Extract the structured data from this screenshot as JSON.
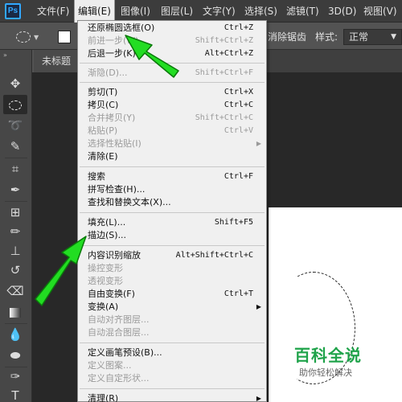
{
  "menubar": {
    "logo": "Ps",
    "items": [
      "文件(F)",
      "编辑(E)",
      "图像(I)",
      "图层(L)",
      "文字(Y)",
      "选择(S)",
      "滤镜(T)",
      "3D(D)",
      "视图(V)"
    ]
  },
  "options": {
    "antialias_label": "消除锯齿",
    "style_label": "样式:",
    "style_value": "正常"
  },
  "document": {
    "tab_title": "未标题"
  },
  "edit_menu": [
    {
      "label": "还原椭圆选框(O)",
      "shortcut": "Ctrl+Z",
      "disabled": false
    },
    {
      "label": "前进一步(W)",
      "shortcut": "Shift+Ctrl+Z",
      "disabled": true
    },
    {
      "label": "后退一步(K)",
      "shortcut": "Alt+Ctrl+Z",
      "disabled": false
    },
    {
      "label": "渐隐(D)...",
      "shortcut": "Shift+Ctrl+F",
      "disabled": true
    },
    {
      "label": "剪切(T)",
      "shortcut": "Ctrl+X",
      "disabled": false
    },
    {
      "label": "拷贝(C)",
      "shortcut": "Ctrl+C",
      "disabled": false
    },
    {
      "label": "合并拷贝(Y)",
      "shortcut": "Shift+Ctrl+C",
      "disabled": true
    },
    {
      "label": "粘贴(P)",
      "shortcut": "Ctrl+V",
      "disabled": true
    },
    {
      "label": "选择性粘贴(I)",
      "shortcut": "",
      "disabled": true,
      "submenu": true
    },
    {
      "label": "清除(E)",
      "shortcut": "",
      "disabled": false
    },
    {
      "label": "搜索",
      "shortcut": "Ctrl+F",
      "disabled": false
    },
    {
      "label": "拼写检查(H)...",
      "shortcut": "",
      "disabled": false
    },
    {
      "label": "查找和替换文本(X)...",
      "shortcut": "",
      "disabled": false
    },
    {
      "label": "填充(L)...",
      "shortcut": "Shift+F5",
      "disabled": false
    },
    {
      "label": "描边(S)...",
      "shortcut": "",
      "disabled": false
    },
    {
      "label": "内容识别缩放",
      "shortcut": "Alt+Shift+Ctrl+C",
      "disabled": false
    },
    {
      "label": "操控变形",
      "shortcut": "",
      "disabled": true
    },
    {
      "label": "透视变形",
      "shortcut": "",
      "disabled": true
    },
    {
      "label": "自由变换(F)",
      "shortcut": "Ctrl+T",
      "disabled": false
    },
    {
      "label": "变换(A)",
      "shortcut": "",
      "disabled": false,
      "submenu": true
    },
    {
      "label": "自动对齐图层...",
      "shortcut": "",
      "disabled": true
    },
    {
      "label": "自动混合图层...",
      "shortcut": "",
      "disabled": true
    },
    {
      "label": "定义画笔预设(B)...",
      "shortcut": "",
      "disabled": false
    },
    {
      "label": "定义图案...",
      "shortcut": "",
      "disabled": true
    },
    {
      "label": "定义自定形状...",
      "shortcut": "",
      "disabled": true
    },
    {
      "label": "清理(R)",
      "shortcut": "",
      "disabled": false,
      "submenu": true
    }
  ],
  "watermark": {
    "title": "百科全说",
    "subtitle": "助你轻松解决"
  },
  "icons": {
    "submenu_arrow": "▶",
    "tools": [
      "move-icon",
      "ellipse-marquee-icon",
      "lasso-icon",
      "quick-select-icon",
      "crop-icon",
      "eyedropper-icon",
      "healing-brush-icon",
      "brush-icon",
      "clone-stamp-icon",
      "history-brush-icon",
      "eraser-icon",
      "gradient-icon",
      "blur-icon",
      "dodge-icon",
      "pen-icon",
      "type-icon"
    ]
  },
  "colors": {
    "arrow_green": "#22dd22",
    "watermark_green": "#1fa34a",
    "ps_blue": "#31a8ff"
  }
}
